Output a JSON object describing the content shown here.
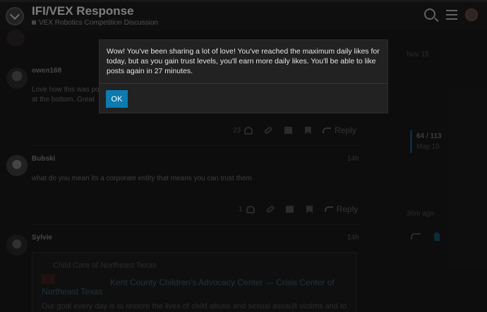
{
  "header": {
    "title": "IFI/VEX Response",
    "category": "VEX Robotics Competition Discussion"
  },
  "posts": [
    {
      "username": "owen168",
      "text_line1": "Love how this was po",
      "text_line2": "at the bottom. Great",
      "like_count": "23"
    },
    {
      "username": "Bubski",
      "date": "14h",
      "text": "what do you mean its a corporate entity that means you can trust them",
      "like_count": "1"
    },
    {
      "username": "Sylvie",
      "date": "14h"
    }
  ],
  "actions": {
    "reply_label": "Reply"
  },
  "onebox": {
    "source": "Child Care of Northeast Texas",
    "title_part1": "Kent County Children's Advocacy Center — Crisis Center of",
    "title_part2": "Northeast Texas",
    "description": "Our goal every day is to restore the lives of child abuse and sexual assault victims and to"
  },
  "timeline": {
    "start_date": "Nov 15",
    "position": "64 / 113",
    "current_date": "May 15",
    "end_label": "36m ago"
  },
  "dialog": {
    "message": "Wow! You've been sharing a lot of love! You've reached the maximum daily likes for today, but as you gain trust levels, you'll earn more daily likes. You'll be able to like posts again in 27 minutes.",
    "ok_label": "OK"
  },
  "colors": {
    "accent": "#0d7ab0",
    "background": "#181818",
    "dialog_bg": "#222222"
  }
}
